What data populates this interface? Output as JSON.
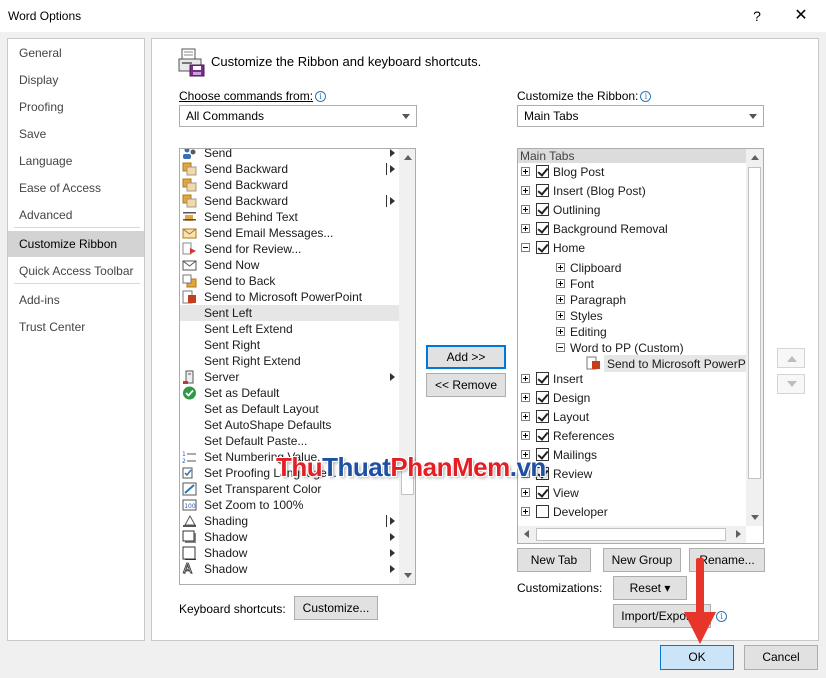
{
  "window": {
    "title": "Word Options",
    "help": "?",
    "close": "✕"
  },
  "nav": {
    "items": [
      {
        "label": "General"
      },
      {
        "label": "Display"
      },
      {
        "label": "Proofing"
      },
      {
        "label": "Save"
      },
      {
        "label": "Language"
      },
      {
        "label": "Ease of Access"
      },
      {
        "label": "Advanced"
      },
      {
        "label": "Customize Ribbon",
        "active": true
      },
      {
        "label": "Quick Access Toolbar"
      },
      {
        "label": "Add-ins"
      },
      {
        "label": "Trust Center"
      }
    ]
  },
  "header": {
    "text": "Customize the Ribbon and keyboard shortcuts."
  },
  "left": {
    "label": "Choose commands from:",
    "combo_value": "All Commands",
    "commands": [
      {
        "label": "Send",
        "icon": "send-people-icon",
        "submenu": true
      },
      {
        "label": "Send Backward",
        "icon": "send-backward-icon",
        "split": true
      },
      {
        "label": "Send Backward",
        "icon": "send-backward-icon"
      },
      {
        "label": "Send Backward",
        "icon": "send-backward-icon",
        "split": true
      },
      {
        "label": "Send Behind Text",
        "icon": "send-behind-text-icon"
      },
      {
        "label": "Send Email Messages...",
        "icon": "email-icon"
      },
      {
        "label": "Send for Review...",
        "icon": "review-icon"
      },
      {
        "label": "Send Now",
        "icon": "send-now-icon"
      },
      {
        "label": "Send to Back",
        "icon": "send-to-back-icon"
      },
      {
        "label": "Send to Microsoft PowerPoint",
        "icon": "powerpoint-icon"
      },
      {
        "label": "Sent Left",
        "selected": true
      },
      {
        "label": "Sent Left Extend"
      },
      {
        "label": "Sent Right"
      },
      {
        "label": "Sent Right Extend"
      },
      {
        "label": "Server",
        "icon": "server-icon",
        "submenu": true
      },
      {
        "label": "Set as Default",
        "icon": "check-circle-icon"
      },
      {
        "label": "Set as Default Layout"
      },
      {
        "label": "Set AutoShape Defaults"
      },
      {
        "label": "Set Default Paste..."
      },
      {
        "label": "Set Numbering Value...",
        "icon": "numbering-icon"
      },
      {
        "label": "Set Proofing Language...",
        "icon": "proofing-language-icon"
      },
      {
        "label": "Set Transparent Color",
        "icon": "transparent-color-icon"
      },
      {
        "label": "Set Zoom to 100%",
        "icon": "zoom-100-icon"
      },
      {
        "label": "Shading",
        "icon": "shading-icon",
        "split": true
      },
      {
        "label": "Shadow",
        "icon": "shadow-square-icon",
        "submenu": true
      },
      {
        "label": "Shadow",
        "icon": "shadow-box-icon",
        "submenu": true
      },
      {
        "label": "Shadow",
        "icon": "text-shadow-icon",
        "submenu": true
      }
    ],
    "keyboard_label": "Keyboard shortcuts:",
    "customize_button": "Customize..."
  },
  "middle": {
    "add_button": "Add >>",
    "remove_button": "<< Remove"
  },
  "right": {
    "label": "Customize the Ribbon:",
    "combo_value": "Main Tabs",
    "tree_header": "Main Tabs",
    "tree": [
      {
        "label": "Blog Post",
        "level": 0,
        "exp": "plus",
        "check": true
      },
      {
        "label": "Insert (Blog Post)",
        "level": 0,
        "exp": "plus",
        "check": true
      },
      {
        "label": "Outlining",
        "level": 0,
        "exp": "plus",
        "check": true
      },
      {
        "label": "Background Removal",
        "level": 0,
        "exp": "plus",
        "check": true
      },
      {
        "label": "Home",
        "level": 0,
        "exp": "minus",
        "check": true
      },
      {
        "label": "Clipboard",
        "level": 1,
        "exp": "plus"
      },
      {
        "label": "Font",
        "level": 1,
        "exp": "plus"
      },
      {
        "label": "Paragraph",
        "level": 1,
        "exp": "plus"
      },
      {
        "label": "Styles",
        "level": 1,
        "exp": "plus"
      },
      {
        "label": "Editing",
        "level": 1,
        "exp": "plus"
      },
      {
        "label": "Word to PP (Custom)",
        "level": 1,
        "exp": "minus"
      },
      {
        "label": "Send to Microsoft PowerPoint",
        "level": 2,
        "selected": true
      },
      {
        "label": "Insert",
        "level": 0,
        "exp": "plus",
        "check": true
      },
      {
        "label": "Design",
        "level": 0,
        "exp": "plus",
        "check": true
      },
      {
        "label": "Layout",
        "level": 0,
        "exp": "plus",
        "check": true
      },
      {
        "label": "References",
        "level": 0,
        "exp": "plus",
        "check": true
      },
      {
        "label": "Mailings",
        "level": 0,
        "exp": "plus",
        "check": true
      },
      {
        "label": "Review",
        "level": 0,
        "exp": "plus",
        "check": true
      },
      {
        "label": "View",
        "level": 0,
        "exp": "plus",
        "check": true
      },
      {
        "label": "Developer",
        "level": 0,
        "exp": "plus",
        "check": false
      }
    ],
    "new_tab_button": "New Tab",
    "new_group_button": "New Group",
    "rename_button": "Rename...",
    "customizations_label": "Customizations:",
    "reset_button": "Reset ▾",
    "import_export_button": "Import/Export ▾"
  },
  "footer": {
    "ok_button": "OK",
    "cancel_button": "Cancel"
  },
  "watermark": {
    "part1": "Thu",
    "part2": "Thuat",
    "part3": "PhanMem",
    "part4": ".vn"
  },
  "colors": {
    "accent": "#0078d7",
    "annotation_arrow": "#e8352c"
  }
}
